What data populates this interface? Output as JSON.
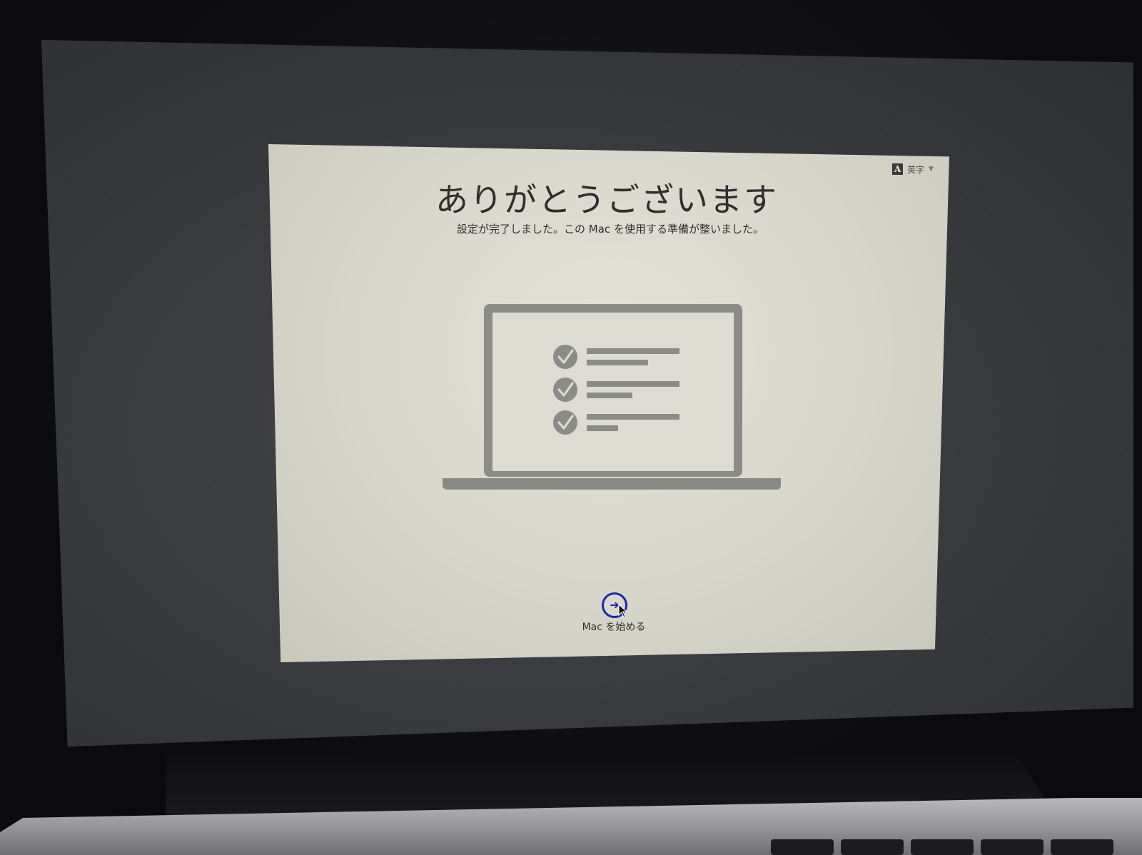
{
  "input_source": {
    "badge_letter": "A",
    "label": "英字",
    "caret": "▼"
  },
  "setup": {
    "title": "ありがとうございます",
    "subtitle": "設定が完了しました。この Mac を使用する準備が整いました。",
    "start_button_label": "Mac を始める",
    "start_button_symbol": "➜",
    "start_button_color": "#1e27a5"
  },
  "illustration": {
    "checklist_items": 3
  }
}
